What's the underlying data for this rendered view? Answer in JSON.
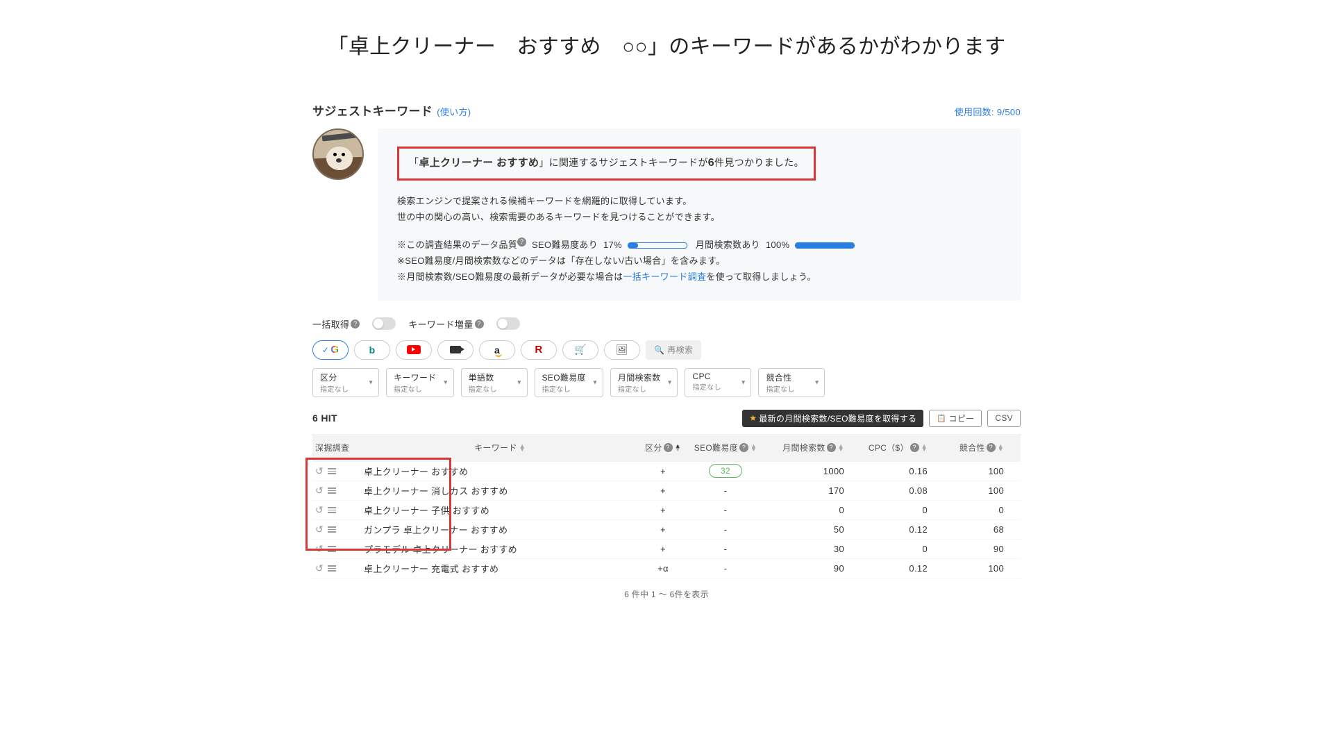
{
  "top_caption": "「卓上クリーナー　おすすめ　○○」のキーワードがあるかがわかります",
  "header": {
    "title": "サジェストキーワード",
    "help_link": "(使い方)",
    "usage": "使用回数: 9/500"
  },
  "info": {
    "highlight_prefix": "「",
    "highlight_keyword": "卓上クリーナー おすすめ",
    "highlight_mid": "」に関連するサジェストキーワードが",
    "highlight_count": "6",
    "highlight_suffix": "件見つかりました。",
    "desc1": "検索エンジンで提案される候補キーワードを網羅的に取得しています。",
    "desc2": "世の中の関心の高い、検索需要のあるキーワードを見つけることができます。",
    "quality_label": "※この調査結果のデータ品質",
    "seo_diff_label": "SEO難易度あり",
    "seo_diff_pct": "17%",
    "monthly_label": "月間検索数あり",
    "monthly_pct": "100%",
    "note1": "※SEO難易度/月間検索数などのデータは「存在しない/古い場合」を含みます。",
    "note2a": "※月間検索数/SEO難易度の最新データが必要な場合は",
    "note2_link": "一括キーワード調査",
    "note2b": "を使って取得しましょう。"
  },
  "toggles": {
    "bulk": "一括取得",
    "amplify": "キーワード増量"
  },
  "re_search": "再検索",
  "filters": [
    {
      "label": "区分",
      "value": "指定なし"
    },
    {
      "label": "キーワード",
      "value": "指定なし"
    },
    {
      "label": "単語数",
      "value": "指定なし"
    },
    {
      "label": "SEO難易度",
      "value": "指定なし"
    },
    {
      "label": "月間検索数",
      "value": "指定なし"
    },
    {
      "label": "CPC",
      "value": "指定なし"
    },
    {
      "label": "競合性",
      "value": "指定なし"
    }
  ],
  "hit_count": "6 HIT",
  "buttons": {
    "fetch_latest": "最新の月間検索数/SEO難易度を取得する",
    "copy": "コピー",
    "csv": "CSV"
  },
  "columns": {
    "deep": "深掘調査",
    "keyword": "キーワード",
    "category": "区分",
    "seo": "SEO難易度",
    "volume": "月間検索数",
    "cpc": "CPC（$）",
    "competition": "競合性"
  },
  "rows": [
    {
      "keyword": "卓上クリーナー おすすめ",
      "category": "+",
      "seo": "32",
      "seo_badge": true,
      "volume": "1000",
      "cpc": "0.16",
      "comp": "100"
    },
    {
      "keyword": "卓上クリーナー 消しカス おすすめ",
      "category": "+",
      "seo": "-",
      "seo_badge": false,
      "volume": "170",
      "cpc": "0.08",
      "comp": "100"
    },
    {
      "keyword": "卓上クリーナー 子供 おすすめ",
      "category": "+",
      "seo": "-",
      "seo_badge": false,
      "volume": "0",
      "cpc": "0",
      "comp": "0"
    },
    {
      "keyword": "ガンプラ 卓上クリーナー おすすめ",
      "category": "+",
      "seo": "-",
      "seo_badge": false,
      "volume": "50",
      "cpc": "0.12",
      "comp": "68"
    },
    {
      "keyword": "プラモデル 卓上クリーナー おすすめ",
      "category": "+",
      "seo": "-",
      "seo_badge": false,
      "volume": "30",
      "cpc": "0",
      "comp": "90"
    },
    {
      "keyword": "卓上クリーナー 充電式 おすすめ",
      "category": "+α",
      "seo": "-",
      "seo_badge": false,
      "volume": "90",
      "cpc": "0.12",
      "comp": "100"
    }
  ],
  "pagination": "6 件中 1 〜 6件を表示"
}
